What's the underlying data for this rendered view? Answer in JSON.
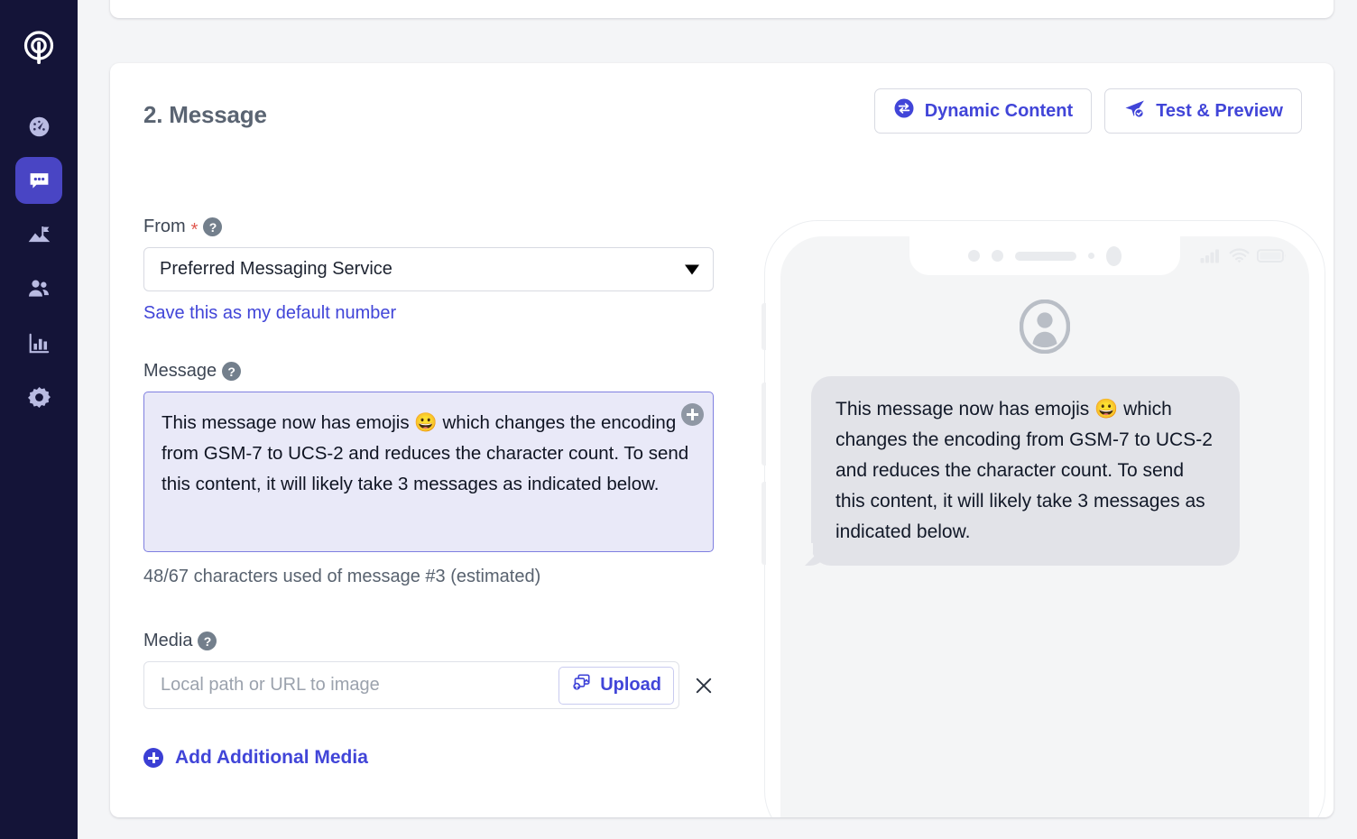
{
  "sidebar": {
    "logo_icon": "antenna-logo-icon",
    "items": [
      {
        "name": "dashboard",
        "icon": "gauge-icon",
        "active": false
      },
      {
        "name": "messaging",
        "icon": "chat-bubble-icon",
        "active": true
      },
      {
        "name": "journeys",
        "icon": "flag-mountain-icon",
        "active": false
      },
      {
        "name": "contacts",
        "icon": "people-icon",
        "active": false
      },
      {
        "name": "analytics",
        "icon": "bar-chart-icon",
        "active": false
      },
      {
        "name": "settings",
        "icon": "gear-icon",
        "active": false
      }
    ]
  },
  "card": {
    "section_title": "2. Message",
    "actions": [
      {
        "label": "Dynamic Content",
        "icon": "dynamic-content-icon"
      },
      {
        "label": "Test & Preview",
        "icon": "paper-plane-check-icon"
      }
    ]
  },
  "form": {
    "from": {
      "label": "From",
      "required_mark": "*",
      "help_icon": "help-icon",
      "selected_option": "Preferred Messaging Service",
      "caret_icon": "chevron-down-icon",
      "save_default_link": "Save this as my default number"
    },
    "message": {
      "label": "Message",
      "help_icon": "help-icon",
      "value": "This message now has emojis 😀 which changes the encoding from GSM-7 to UCS-2 and reduces the character count. To send this content, it will likely take 3 messages as indicated below.",
      "insert_icon": "plus-circle-icon",
      "character_count": "48/67 characters used of message #3 (estimated)"
    },
    "media": {
      "label": "Media",
      "help_icon": "help-icon",
      "input_value": "",
      "input_placeholder": "Local path or URL to image",
      "upload_label": "Upload",
      "upload_icon": "image-upload-icon",
      "remove_icon": "close-icon",
      "add_more_label": "Add Additional Media",
      "add_more_icon": "plus-circle-icon"
    }
  },
  "preview": {
    "device_icons": {
      "avatar": "contact-avatar-icon",
      "signal": "signal-bars-icon",
      "wifi": "wifi-icon",
      "battery": "battery-icon"
    },
    "bubble_text": "This message now has emojis 😀 which changes the encoding from GSM-7 to UCS-2 and reduces the character count. To send this content, it will likely take 3 messages as indicated below.",
    "scrollbar": "horizontal-scrollbar"
  },
  "colors": {
    "sidebar_bg": "#141438",
    "accent": "#4145d8",
    "active_nav": "#4945c4",
    "message_box_bg": "#e9e9f8",
    "bubble_bg": "#e2e3e8",
    "required": "#e0584f",
    "page_bg": "#f4f5f7"
  }
}
